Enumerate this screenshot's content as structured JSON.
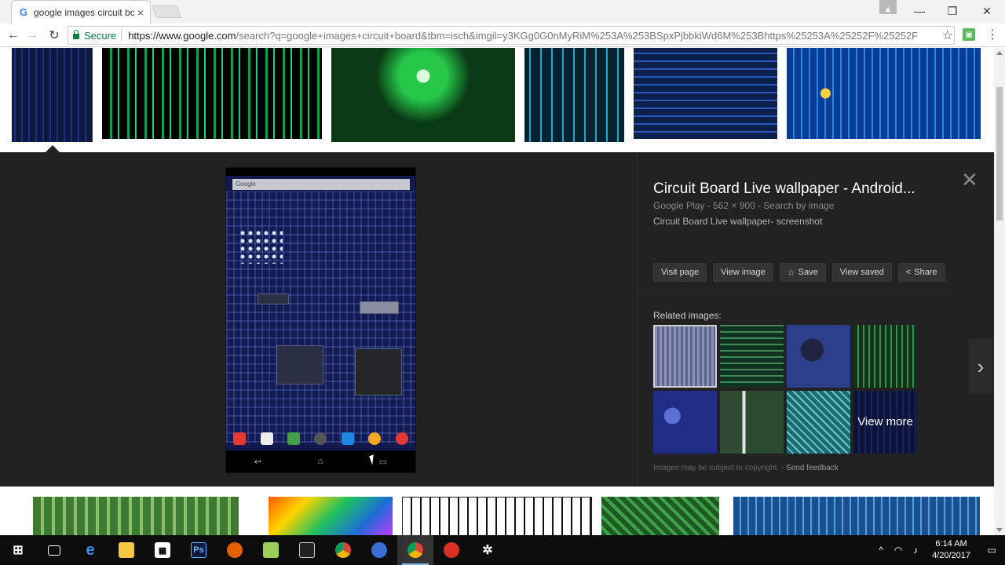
{
  "browser": {
    "tab_title": "google images circuit bo",
    "url_secure_label": "Secure",
    "url_host": "https://www.google.com",
    "url_path": "/search?q=google+images+circuit+board&tbm=isch&imgil=y3KGg0G0nMyRiM%253A%253BSpxPjbbkiWd6M%253Bhttps%25253A%25252F%25252F"
  },
  "panel": {
    "title": "Circuit Board Live wallpaper - Android...",
    "meta": "Google Play  -  562 × 900  -  Search by image",
    "description": "Circuit Board Live wallpaper- screenshot",
    "preview_search": "Google",
    "buttons": {
      "visit": "Visit page",
      "view_image": "View image",
      "save": "Save",
      "view_saved": "View saved",
      "share": "Share"
    },
    "related_label": "Related images:",
    "view_more": "View more",
    "copyright": "Images may be subject to copyright.",
    "feedback": "Send feedback"
  },
  "taskbar": {
    "time": "6:14 AM",
    "date": "4/20/2017"
  }
}
